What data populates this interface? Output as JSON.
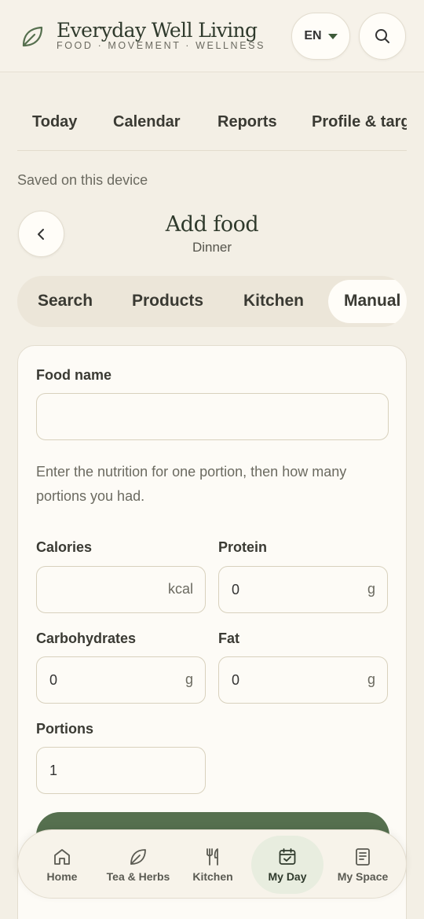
{
  "header": {
    "brand_title": "Everyday Well Living",
    "brand_tagline": "FOOD · MOVEMENT · WELLNESS",
    "language": "EN"
  },
  "topnav": {
    "items": [
      "Today",
      "Calendar",
      "Reports",
      "Profile & targ"
    ]
  },
  "saved_note": "Saved on this device",
  "page": {
    "title": "Add food",
    "subtitle": "Dinner"
  },
  "segments": {
    "items": [
      "Search",
      "Products",
      "Kitchen",
      "Manual"
    ],
    "active": "Manual"
  },
  "form": {
    "food_name_label": "Food name",
    "food_name_value": "",
    "help_text": "Enter the nutrition for one portion, then how many portions you had.",
    "calories_label": "Calories",
    "calories_value": "",
    "calories_unit": "kcal",
    "protein_label": "Protein",
    "protein_value": "0",
    "protein_unit": "g",
    "carbs_label": "Carbohydrates",
    "carbs_value": "0",
    "carbs_unit": "g",
    "fat_label": "Fat",
    "fat_value": "0",
    "fat_unit": "g",
    "portions_label": "Portions",
    "portions_value": "1"
  },
  "bottomnav": {
    "items": [
      {
        "label": "Home",
        "icon": "home-icon"
      },
      {
        "label": "Tea & Herbs",
        "icon": "leaf-icon"
      },
      {
        "label": "Kitchen",
        "icon": "fork-knife-icon"
      },
      {
        "label": "My Day",
        "icon": "calendar-check-icon"
      },
      {
        "label": "My Space",
        "icon": "notebook-icon"
      }
    ],
    "active": "My Day"
  },
  "colors": {
    "accent": "#56704f",
    "background": "#f3efe5",
    "card": "#fdfbf6"
  }
}
